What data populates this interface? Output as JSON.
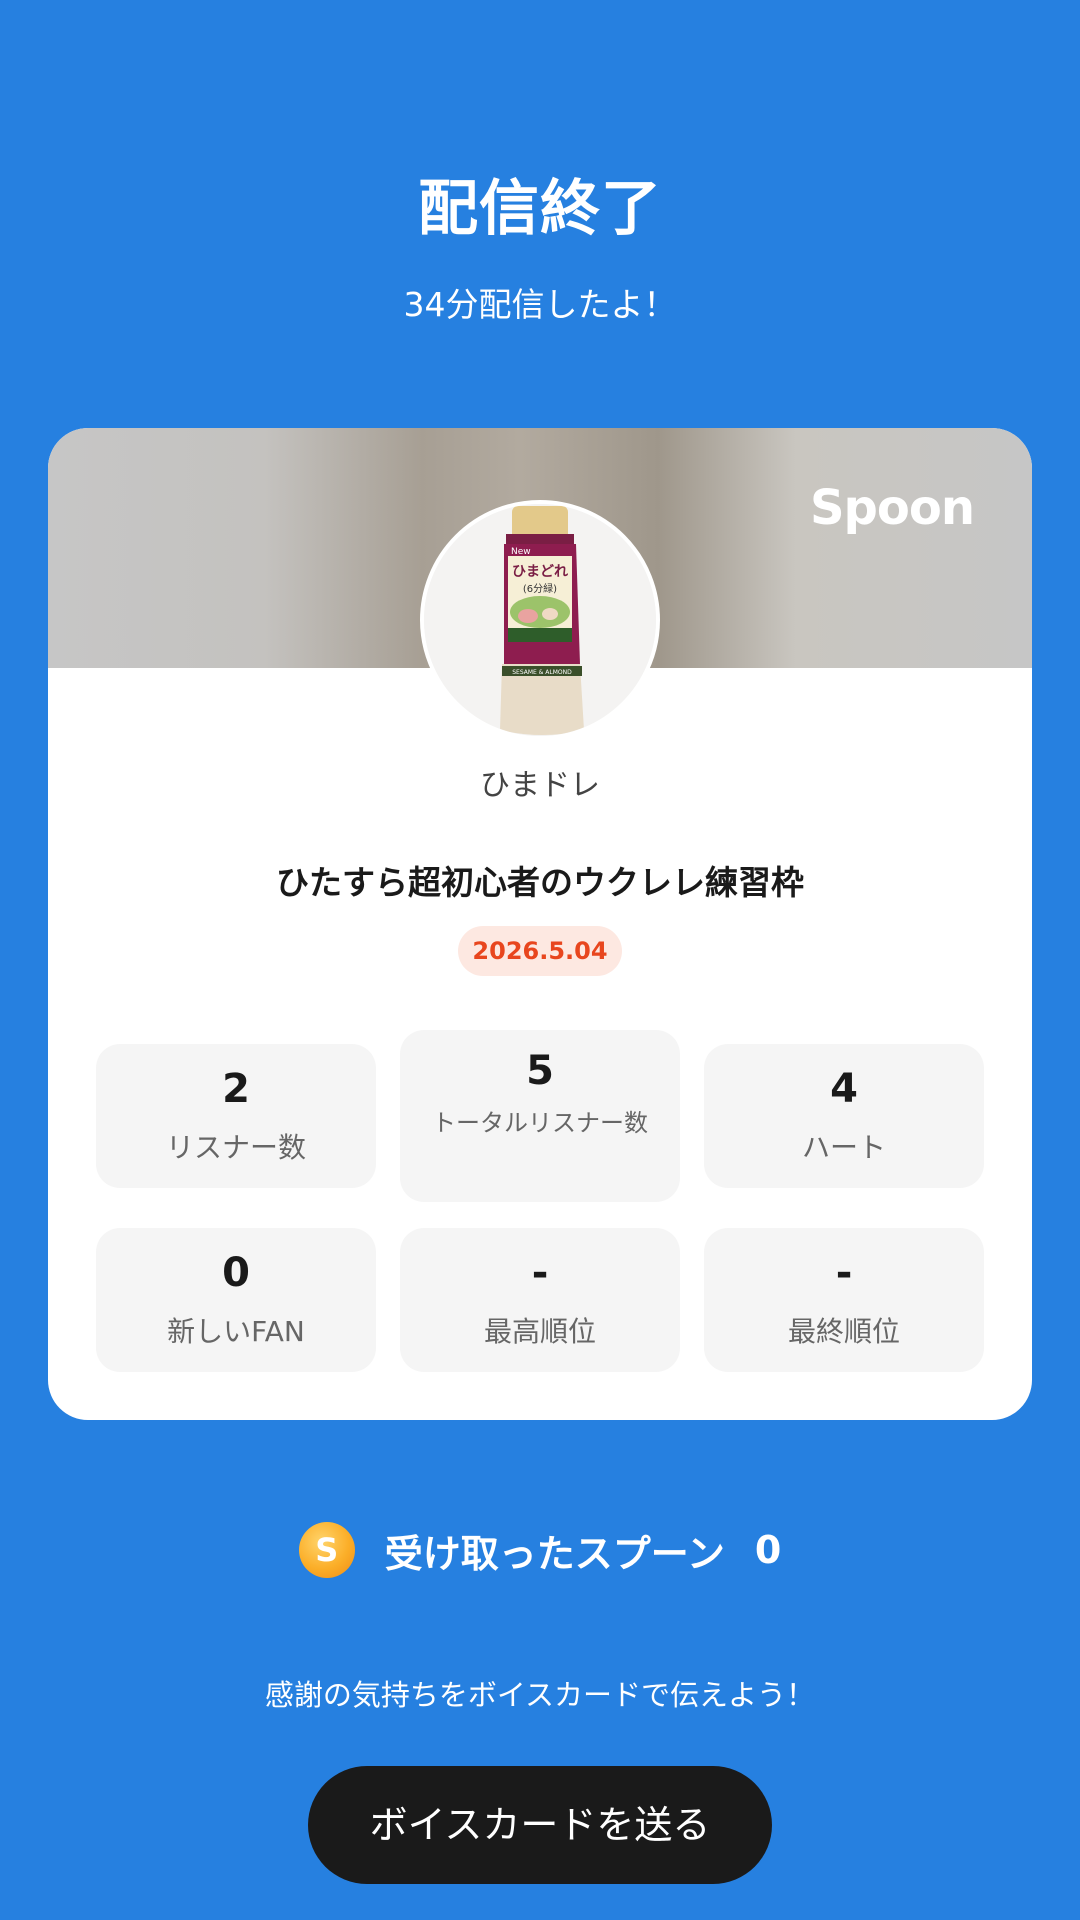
{
  "header": {
    "title": "配信終了",
    "subtitle": "34分配信したよ！"
  },
  "card": {
    "brand": "Spoon",
    "host_name": "ひまドレ",
    "stream_title": "ひたすら超初心者のウクレレ練習枠",
    "date": "2026.5.04",
    "stats": [
      {
        "value": "2",
        "label": "リスナー数"
      },
      {
        "value": "5",
        "label": "トータルリスナー数"
      },
      {
        "value": "4",
        "label": "ハート"
      },
      {
        "value": "0",
        "label": "新しいFAN"
      },
      {
        "value": "-",
        "label": "最高順位"
      },
      {
        "value": "-",
        "label": "最終順位"
      }
    ],
    "avatar_product": {
      "badge": "New",
      "name": "ひまどれ",
      "sub": "(6分緑)",
      "flavor": "SESAME & ALMOND"
    }
  },
  "spoons": {
    "icon_letter": "S",
    "label": "受け取ったスプーン",
    "count": "0"
  },
  "thanks_text": "感謝の気持ちをボイスカードで伝えよう！",
  "voice_card_button": "ボイスカードを送る",
  "colors": {
    "background": "#2680e0",
    "date_badge_text": "#e8461e",
    "date_badge_bg": "#fde8e1",
    "button_bg": "#1a1a1a"
  }
}
